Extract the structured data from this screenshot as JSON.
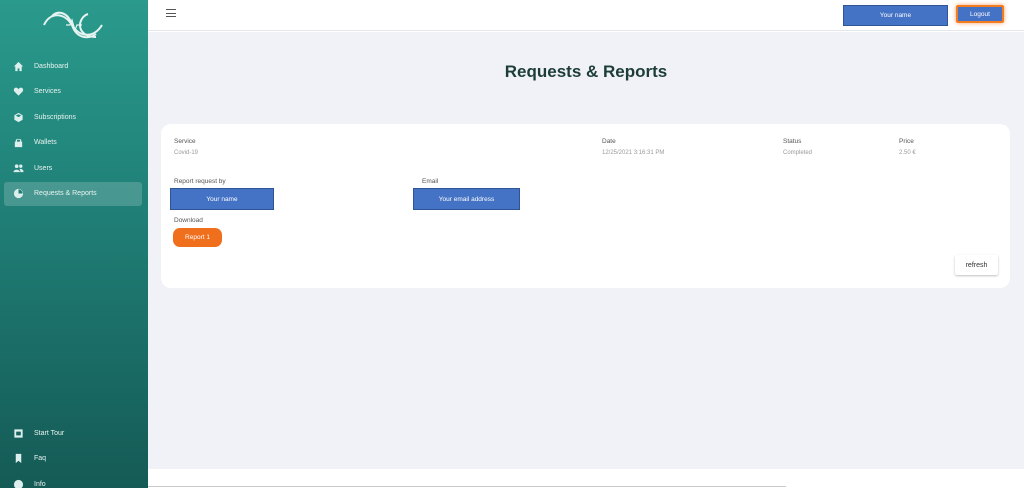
{
  "sidebar": {
    "items": [
      {
        "label": "Dashboard",
        "icon": "home-icon"
      },
      {
        "label": "Services",
        "icon": "heart-icon"
      },
      {
        "label": "Subscriptions",
        "icon": "cube-icon"
      },
      {
        "label": "Wallets",
        "icon": "lock-icon"
      },
      {
        "label": "Users",
        "icon": "users-icon"
      },
      {
        "label": "Requests & Reports",
        "icon": "report-icon"
      }
    ],
    "bottom_items": [
      {
        "label": "Start Tour",
        "icon": "tour-icon"
      },
      {
        "label": "Faq",
        "icon": "bookmark-icon"
      },
      {
        "label": "Info",
        "icon": "info-icon"
      }
    ]
  },
  "header": {
    "user_name": "Your name",
    "logout": "Logout"
  },
  "page": {
    "title": "Requests & Reports"
  },
  "report": {
    "service_label": "Service",
    "service_value": "Covid-19",
    "date_label": "Date",
    "date_value": "12/25/2021 3:16:31 PM",
    "status_label": "Status",
    "status_value": "Completed",
    "price_label": "Price",
    "price_value": "2.50 €",
    "requested_by_label": "Report request by",
    "requested_by_value": "Your name",
    "email_label": "Email",
    "email_value": "Your email address",
    "download_label": "Download",
    "download_button": "Report 1",
    "refresh_button": "refresh"
  },
  "colors": {
    "sidebar_top": "#2a9a8c",
    "sidebar_bottom": "#155a55",
    "primary_blue": "#4472c4",
    "accent_orange": "#ef6f1d"
  }
}
